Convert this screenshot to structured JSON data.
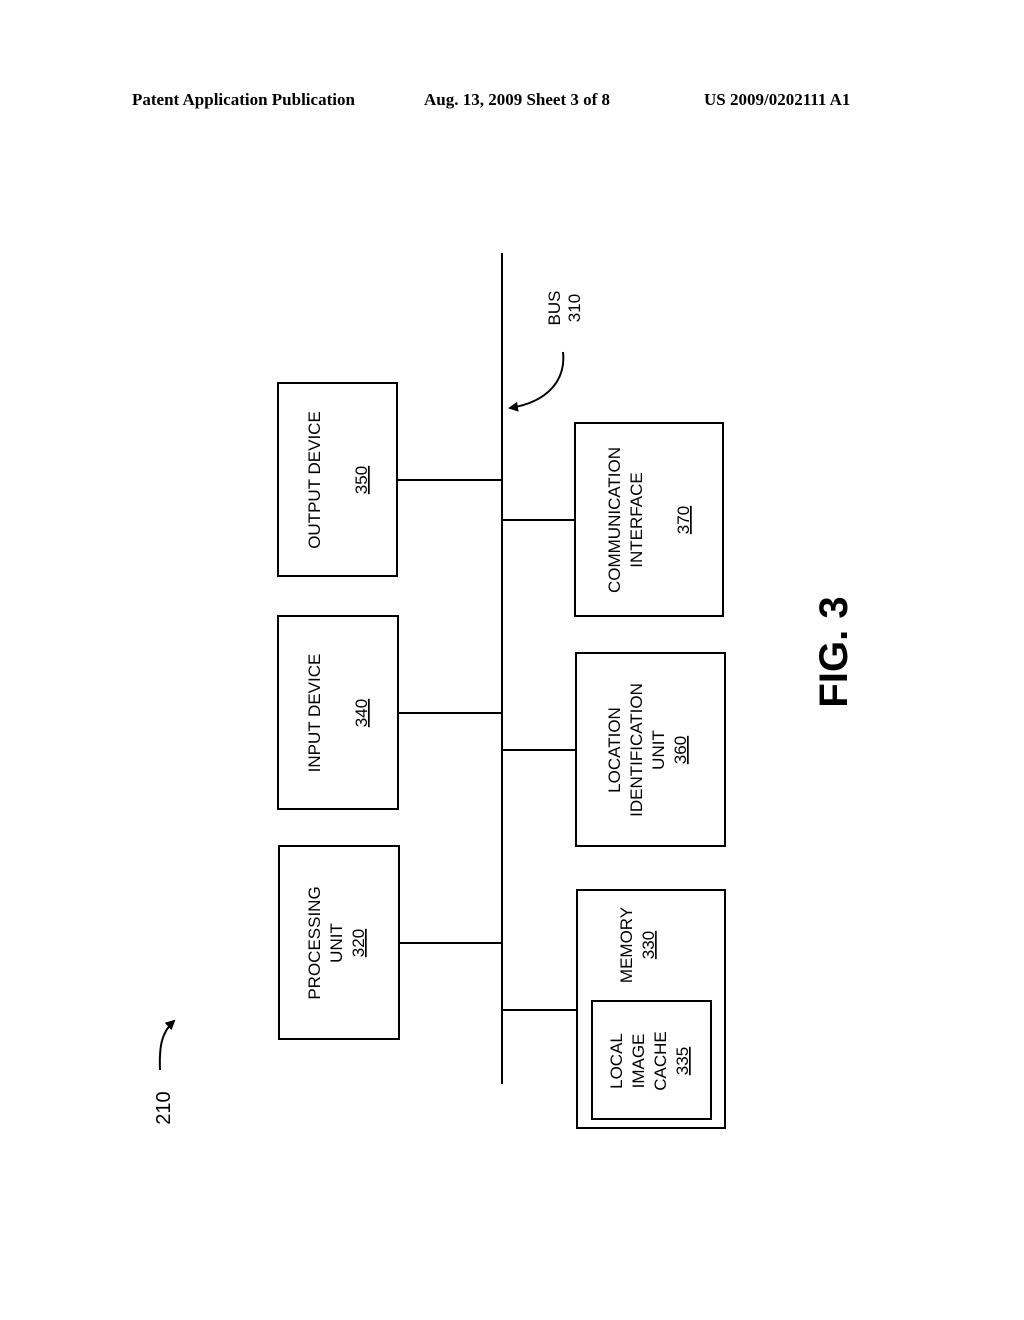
{
  "header": {
    "publication": "Patent Application Publication",
    "date_sheet": "Aug. 13, 2009  Sheet 3 of 8",
    "number": "US 2009/0202111 A1"
  },
  "figure": {
    "label": "FIG. 3",
    "reference": "210",
    "bus": {
      "label": "BUS",
      "ref": "310"
    },
    "blocks": [
      {
        "id": "processing-unit",
        "lines": [
          "PROCESSING",
          "UNIT"
        ],
        "ref": "320"
      },
      {
        "id": "input-device",
        "lines": [
          "INPUT DEVICE"
        ],
        "ref": "340"
      },
      {
        "id": "output-device",
        "lines": [
          "OUTPUT DEVICE"
        ],
        "ref": "350"
      },
      {
        "id": "memory",
        "lines": [
          "MEMORY"
        ],
        "ref": "330"
      },
      {
        "id": "local-image-cache",
        "lines": [
          "LOCAL",
          "IMAGE",
          "CACHE"
        ],
        "ref": "335"
      },
      {
        "id": "location-identification-unit",
        "lines": [
          "LOCATION",
          "IDENTIFICATION",
          "UNIT"
        ],
        "ref": "360"
      },
      {
        "id": "communication-interface",
        "lines": [
          "COMMUNICATION",
          "INTERFACE"
        ],
        "ref": "370"
      }
    ]
  }
}
